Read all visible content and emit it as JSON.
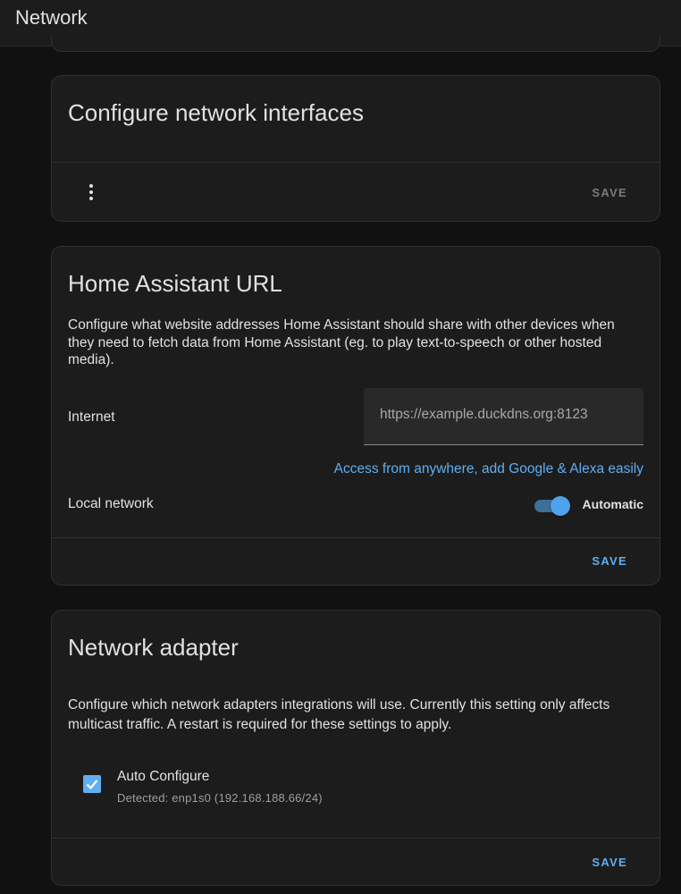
{
  "header": {
    "title": "Network"
  },
  "interfaces_card": {
    "title": "Configure network interfaces",
    "save_label": "SAVE",
    "menu_icon": "more-vertical-icon"
  },
  "url_card": {
    "title": "Home Assistant URL",
    "description": "Configure what website addresses Home Assistant should share with other devices when they need to fetch data from Home Assistant (eg. to play text-to-speech or other hosted media).",
    "internet_label": "Internet",
    "internet_placeholder": "https://example.duckdns.org:8123",
    "cloud_link": "Access from anywhere, add Google & Alexa easily",
    "local_label": "Local network",
    "automatic_label": "Automatic",
    "automatic_enabled": true,
    "save_label": "SAVE"
  },
  "adapter_card": {
    "title": "Network adapter",
    "description": "Configure which network adapters integrations will use. Currently this setting only affects multicast traffic. A restart is required for these settings to apply.",
    "auto_configure_label": "Auto Configure",
    "auto_configure_checked": true,
    "detected_text": "Detected: enp1s0 (192.168.188.66/24)",
    "save_label": "SAVE"
  },
  "colors": {
    "accent": "#61aef0",
    "background": "#111111",
    "card": "#1c1c1c",
    "text": "#e1e1e1",
    "disabled": "#7a7a7a"
  }
}
